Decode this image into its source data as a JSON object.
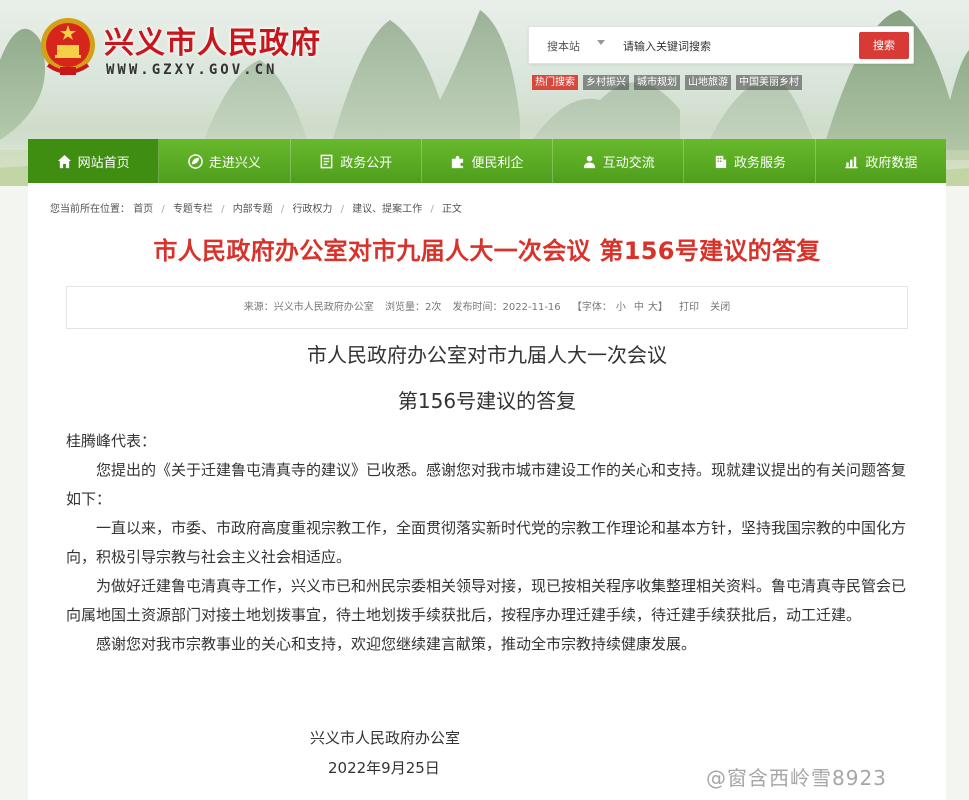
{
  "header": {
    "site_name": "兴义市人民政府",
    "domain": "WWW.GZXY.GOV.CN"
  },
  "search": {
    "scope": "搜本站",
    "placeholder": "请输入关键词搜索",
    "button": "搜索"
  },
  "hot_tags": [
    "热门搜索",
    "乡村振兴",
    "城市规划",
    "山地旅游",
    "中国美丽乡村"
  ],
  "nav": [
    {
      "label": "网站首页",
      "icon": "home-icon"
    },
    {
      "label": "走进兴义",
      "icon": "leaf-icon"
    },
    {
      "label": "政务公开",
      "icon": "document-icon"
    },
    {
      "label": "便民利企",
      "icon": "puzzle-icon"
    },
    {
      "label": "互动交流",
      "icon": "chat-icon"
    },
    {
      "label": "政务服务",
      "icon": "building-icon"
    },
    {
      "label": "政府数据",
      "icon": "chart-icon"
    }
  ],
  "breadcrumb": {
    "prefix": "您当前所在位置：",
    "items": [
      "首页",
      "专题专栏",
      "内部专题",
      "行政权力",
      "建议、提案工作",
      "正文"
    ]
  },
  "article": {
    "title": "市人民政府办公室对市九届人大一次会议 第156号建议的答复",
    "meta": {
      "source": "来源：兴义市人民政府办公室",
      "views": "浏览量：2次",
      "published": "发布时间：2022-11-16",
      "font_label": "【字体：",
      "font_small": "小",
      "font_medium": "中",
      "font_large": "大】",
      "print": "打印",
      "close": "关闭"
    },
    "subtitle_line1": "市人民政府办公室对市九届人大一次会议",
    "subtitle_line2": "第156号建议的答复",
    "salutation": "桂腾峰代表：",
    "paragraphs": [
      "您提出的《关于迁建鲁屯清真寺的建议》已收悉。感谢您对我市城市建设工作的关心和支持。现就建议提出的有关问题答复如下：",
      "一直以来，市委、市政府高度重视宗教工作，全面贯彻落实新时代党的宗教工作理论和基本方针，坚持我国宗教的中国化方向，积极引导宗教与社会主义社会相适应。",
      "为做好迁建鲁屯清真寺工作，兴义市已和州民宗委相关领导对接，现已按相关程序收集整理相关资料。鲁屯清真寺民管会已向属地国土资源部门对接土地划拨事宜，待土地划拨手续获批后，按程序办理迁建手续，待迁建手续获批后，动工迁建。",
      "感谢您对我市宗教事业的关心和支持，欢迎您继续建言献策，推动全市宗教持续健康发展。"
    ],
    "signature_org": "兴义市人民政府办公室",
    "signature_date": "2022年9月25日"
  },
  "watermark": "@窗含西岭雪8923",
  "colors": {
    "brand_red": "#c8161d",
    "title_red": "#d8322a",
    "nav_green": "#58a823",
    "search_red": "#d83a36"
  }
}
